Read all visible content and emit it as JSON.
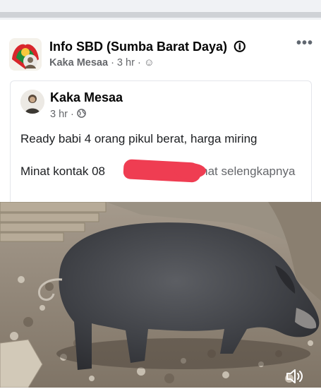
{
  "group": {
    "name": "Info SBD (Sumba Barat Daya)",
    "name_suffix_icon": "question-diamond-icon",
    "author": "Kaka Mesaa",
    "time": "3 hr",
    "audience_icon": "group-audience-icon"
  },
  "shared_post": {
    "author": "Kaka Mesaa",
    "time": "3 hr",
    "audience_icon": "globe-icon",
    "text_line1": "Ready babi 4 orang pikul berat, harga miring",
    "text_line2_prefix": "Minat kontak 08",
    "see_more": "... Lihat selengkapnya"
  },
  "media": {
    "subject": "black pig photo",
    "sound_icon": "volume-icon"
  },
  "colors": {
    "redaction": "#ef3d52",
    "meta_gray": "#65676b"
  }
}
